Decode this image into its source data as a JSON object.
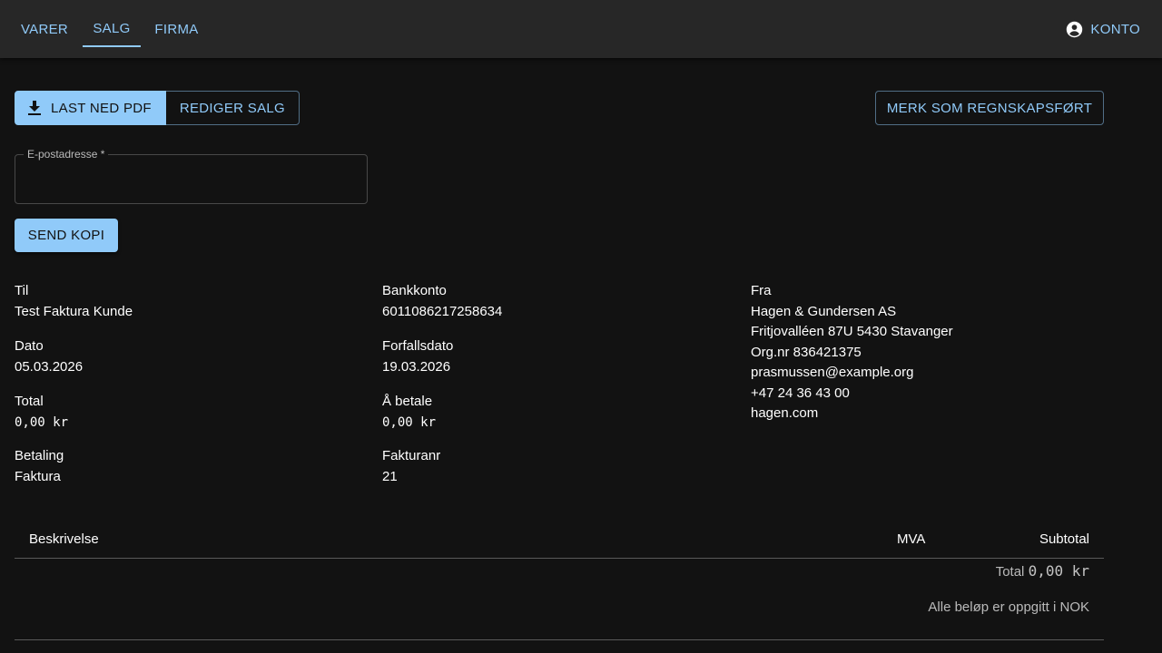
{
  "nav": {
    "tabs": [
      {
        "label": "VARER"
      },
      {
        "label": "SALG"
      },
      {
        "label": "FIRMA"
      }
    ],
    "account_label": "KONTO"
  },
  "toolbar": {
    "download_label": "LAST NED PDF",
    "edit_label": "REDIGER SALG",
    "mark_label": "MERK SOM REGNSKAPSFØRT"
  },
  "email": {
    "label": "E-postadresse *",
    "value": "",
    "send_label": "SEND KOPI"
  },
  "details": {
    "til_label": "Til",
    "til_value": "Test Faktura Kunde",
    "dato_label": "Dato",
    "dato_value": "05.03.2026",
    "total_label": "Total",
    "total_value": "0,00 kr",
    "betaling_label": "Betaling",
    "betaling_value": "Faktura",
    "bank_label": "Bankkonto",
    "bank_value": "6011086217258634",
    "forfall_label": "Forfallsdato",
    "forfall_value": "19.03.2026",
    "abetale_label": "Å betale",
    "abetale_value": "0,00 kr",
    "fakturanr_label": "Fakturanr",
    "fakturanr_value": "21",
    "fra_label": "Fra",
    "fra_lines": [
      "Hagen & Gundersen AS",
      "Fritjovalléen 87U 5430 Stavanger",
      "Org.nr 836421375",
      "prasmussen@example.org",
      "+47 24 36 43 00",
      "hagen.com"
    ]
  },
  "table": {
    "col_beskrivelse": "Beskrivelse",
    "col_mva": "MVA",
    "col_subtotal": "Subtotal",
    "total_label": "Total",
    "total_value": "0,00 kr",
    "note": "Alle beløp er oppgitt i NOK"
  },
  "colors": {
    "accent": "#90caf9",
    "background": "#121212",
    "appbar": "#272727"
  }
}
